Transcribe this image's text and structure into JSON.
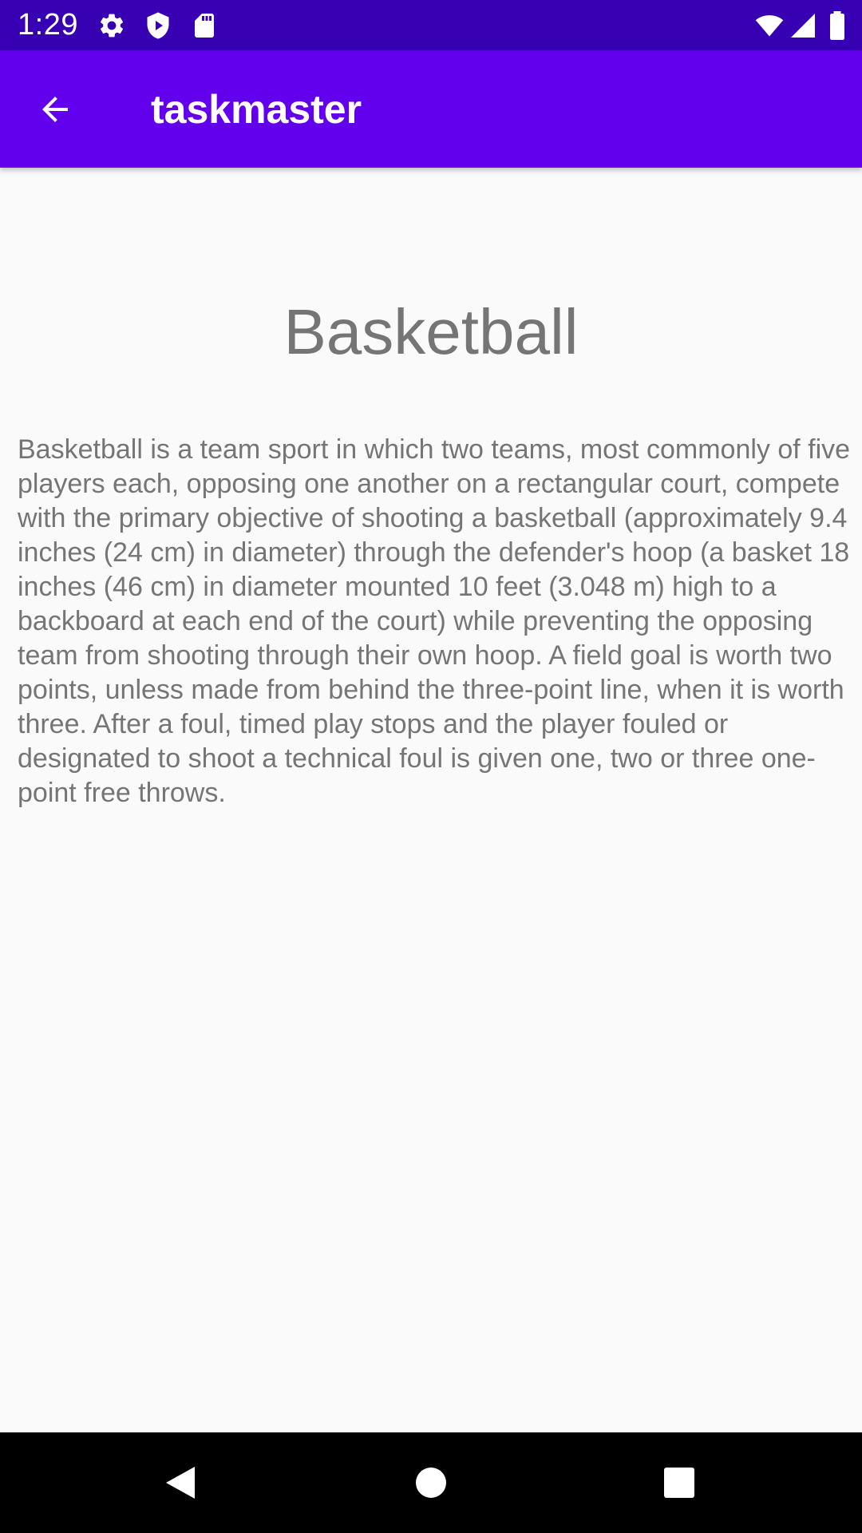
{
  "status_bar": {
    "time": "1:29",
    "background": "#3700b3",
    "left_icons": [
      "settings-gear-icon",
      "shield-play-icon",
      "sd-card-icon"
    ],
    "right_icons": [
      "wifi-icon",
      "cellular-signal-icon",
      "battery-icon"
    ]
  },
  "app_bar": {
    "title": "taskmaster",
    "background": "#6200ee",
    "back_icon": "arrow-back-icon"
  },
  "task": {
    "title": "Basketball",
    "body": "Basketball is a team sport in which two teams, most commonly of five players each, opposing one another on a rectangular court, compete with the primary objective of shooting a basketball (approximately 9.4 inches (24 cm) in diameter) through the defender's hoop (a basket 18 inches (46 cm) in diameter mounted 10 feet (3.048 m) high to a backboard at each end of the court) while preventing the opposing team from shooting through their own hoop. A field goal is worth two points, unless made from behind the three-point line, when it is worth three. After a foul, timed play stops and the player fouled or designated to shoot a technical foul is given one, two or three one-point free throws."
  },
  "nav_bar": {
    "background": "#000000",
    "buttons": [
      "back-triangle-icon",
      "home-circle-icon",
      "recents-square-icon"
    ]
  }
}
